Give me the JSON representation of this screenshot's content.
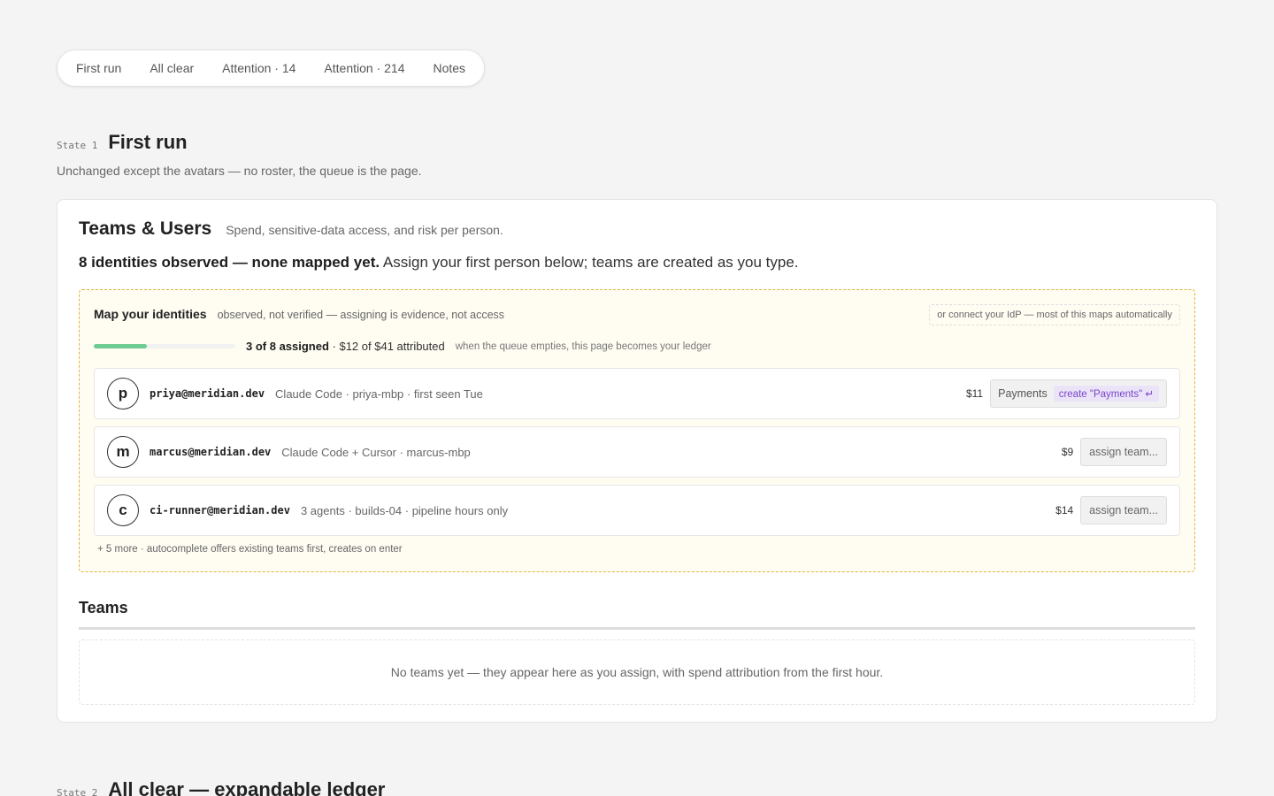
{
  "tabs": [
    "First run",
    "All clear",
    "Attention · 14",
    "Attention · 214",
    "Notes"
  ],
  "state1": {
    "label": "State 1",
    "title": "First run",
    "description": "Unchanged except the avatars — no roster, the queue is the page."
  },
  "card": {
    "title": "Teams & Users",
    "subtitle": "Spend, sensitive-data access, and risk per person.",
    "headline_bold": "8 identities observed — none mapped yet.",
    "headline_rest": " Assign your first person below; teams are created as you type."
  },
  "map": {
    "title": "Map your identities",
    "subtitle": "observed, not verified — assigning is evidence, not access",
    "idp_link": "or connect your IdP — most of this maps automatically",
    "progress_fraction": 0.375,
    "progress_bold": "3 of 8 assigned",
    "progress_rest": " · $12 of $41 attributed",
    "progress_note": "when the queue empties, this page becomes your ledger",
    "rows": [
      {
        "initial": "p",
        "email": "priya@meridian.dev",
        "meta": "Claude Code · priya-mbp · first seen Tue",
        "amount": "$11",
        "team_value": "Payments",
        "create_label": "create \"Payments\" ↵"
      },
      {
        "initial": "m",
        "email": "marcus@meridian.dev",
        "meta": "Claude Code + Cursor · marcus-mbp",
        "amount": "$9",
        "assign_label": "assign team..."
      },
      {
        "initial": "c",
        "email": "ci-runner@meridian.dev",
        "meta": "3 agents · builds-04 · pipeline hours only",
        "amount": "$14",
        "assign_label": "assign team..."
      }
    ],
    "more_note": "+ 5 more · autocomplete offers existing teams first, creates on enter"
  },
  "teams": {
    "title": "Teams",
    "empty_text": "No teams yet — they appear here as you assign, with spend attribution from the first hour."
  },
  "state2": {
    "label": "State 2",
    "title": "All clear — expandable ledger"
  },
  "colors": {
    "progress_fill": "#6ecb91",
    "map_border": "#e0b53c",
    "create_chip": "#7a45c9"
  }
}
